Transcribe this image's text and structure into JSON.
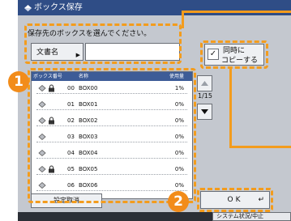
{
  "window": {
    "title": "ボックス保存"
  },
  "prompt": "保存先のボックスを選んでください。",
  "doc_name_button": "文書名",
  "copy_button": {
    "line1": "同時に",
    "line2": "コピーする",
    "checked": true
  },
  "table": {
    "headers": {
      "box_no": "ボックス番号",
      "name": "名称",
      "usage": "使用量"
    },
    "rows": [
      {
        "num": "00",
        "name": "BOX00",
        "usage": "1%",
        "locked": true
      },
      {
        "num": "01",
        "name": "BOX01",
        "usage": "0%",
        "locked": false
      },
      {
        "num": "02",
        "name": "BOX02",
        "usage": "0%",
        "locked": true
      },
      {
        "num": "03",
        "name": "BOX03",
        "usage": "0%",
        "locked": false
      },
      {
        "num": "04",
        "name": "BOX04",
        "usage": "0%",
        "locked": false
      },
      {
        "num": "05",
        "name": "BOX05",
        "usage": "0%",
        "locked": true
      },
      {
        "num": "06",
        "name": "BOX06",
        "usage": "0%",
        "locked": false
      }
    ]
  },
  "page_indicator": "1/15",
  "cancel_settings": "設定取消",
  "ok": "OK",
  "status_button": "システム状況/中止",
  "callout_numbers": {
    "one": "1",
    "two": "2"
  },
  "colors": {
    "title_bar": "#2f4d86",
    "accent_orange": "#f39c1d"
  }
}
